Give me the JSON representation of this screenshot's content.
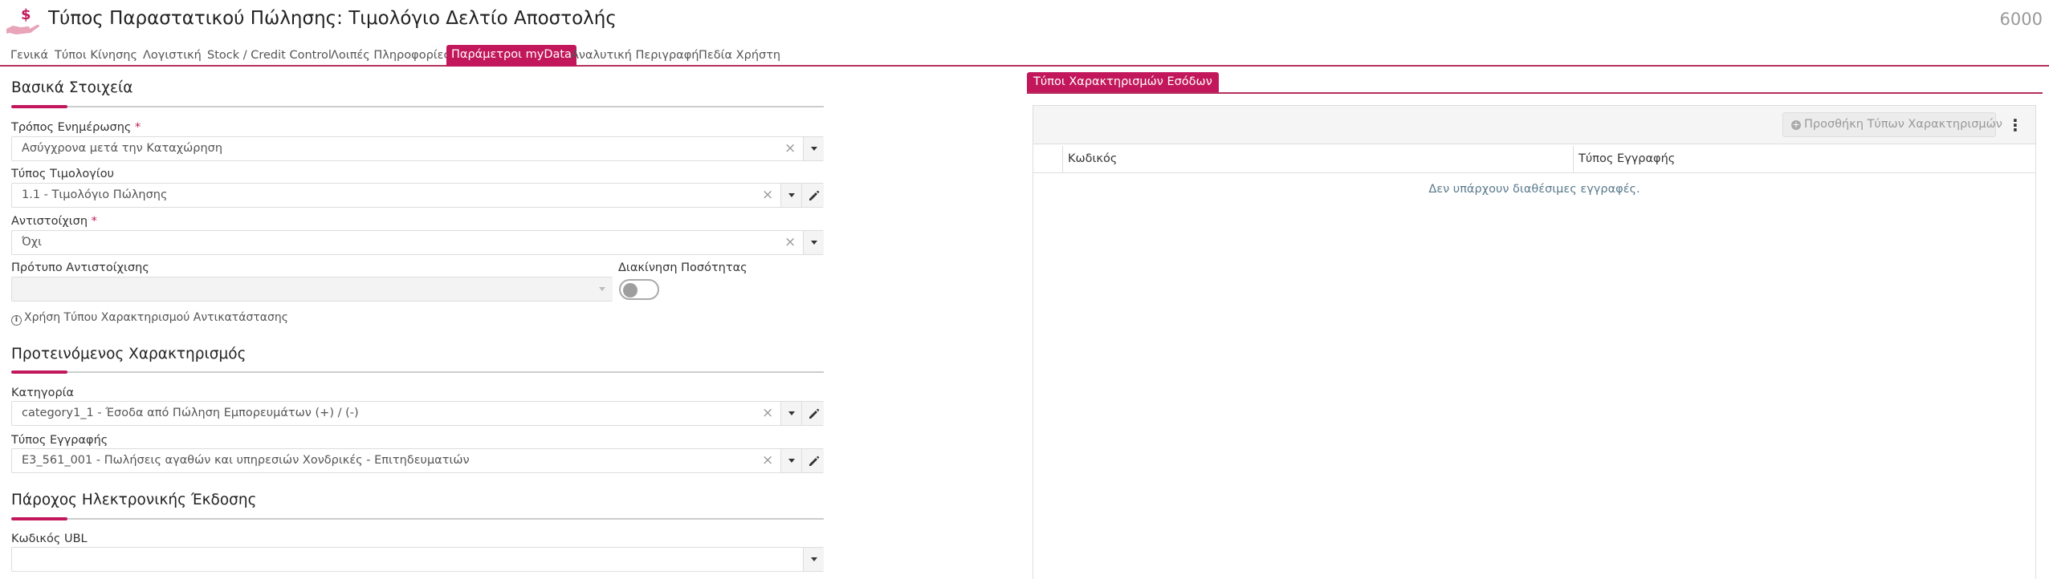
{
  "header": {
    "title": "Τύπος Παραστατικού Πώλησης: Τιμολόγιο Δελτίο Αποστολής",
    "code": "6000",
    "icon": "hand-money-icon"
  },
  "tabs": [
    {
      "label": "Γενικά",
      "active": false
    },
    {
      "label": "Τύποι Κίνησης",
      "active": false
    },
    {
      "label": "Λογιστική",
      "active": false
    },
    {
      "label": "Stock / Credit Control",
      "active": false
    },
    {
      "label": "Λοιπές Πληροφορίες",
      "active": false
    },
    {
      "label": "Παράμετροι myData",
      "active": true
    },
    {
      "label": "Αναλυτική Περιγραφή",
      "active": false
    },
    {
      "label": "Πεδία Χρήστη",
      "active": false
    }
  ],
  "basic": {
    "title": "Βασικά Στοιχεία",
    "update_mode": {
      "label": "Τρόπος Ενημέρωσης",
      "required": "*",
      "value": "Ασύγχρονα μετά την Καταχώρηση"
    },
    "invoice_type": {
      "label": "Τύπος Τιμολογίου",
      "value": "1.1 - Τιμολόγιο Πώλησης"
    },
    "matching": {
      "label": "Αντιστοίχιση",
      "required": "*",
      "value": "Όχι"
    },
    "matching_template": {
      "label": "Πρότυπο Αντιστοίχισης",
      "value": ""
    },
    "quantity_movement": {
      "label": "Διακίνηση Ποσότητας",
      "on": false
    },
    "info_text": "Χρήση Τύπου Χαρακτηρισμού Αντικατάστασης"
  },
  "suggested": {
    "title": "Προτεινόμενος Χαρακτηρισμός",
    "category": {
      "label": "Κατηγορία",
      "value": "category1_1 - Έσοδα από Πώληση Εμπορευμάτων (+) / (-)"
    },
    "record_type": {
      "label": "Τύπος Εγγραφής",
      "value": "E3_561_001 - Πωλήσεις αγαθών και υπηρεσιών Χονδρικές - Επιτηδευματιών"
    }
  },
  "provider": {
    "title": "Πάροχος Ηλεκτρονικής Έκδοσης",
    "ubl": {
      "label": "Κωδικός UBL",
      "value": ""
    }
  },
  "right": {
    "tab_label": "Τύποι Χαρακτηρισμών Εσόδων",
    "add_button": "Προσθήκη Τύπων Χαρακτηρισμών",
    "columns": [
      "Κωδικός",
      "Τύπος Εγγραφής"
    ],
    "empty_text": "Δεν υπάρχουν διαθέσιμες εγγραφές."
  },
  "colors": {
    "accent": "#c2185b"
  }
}
